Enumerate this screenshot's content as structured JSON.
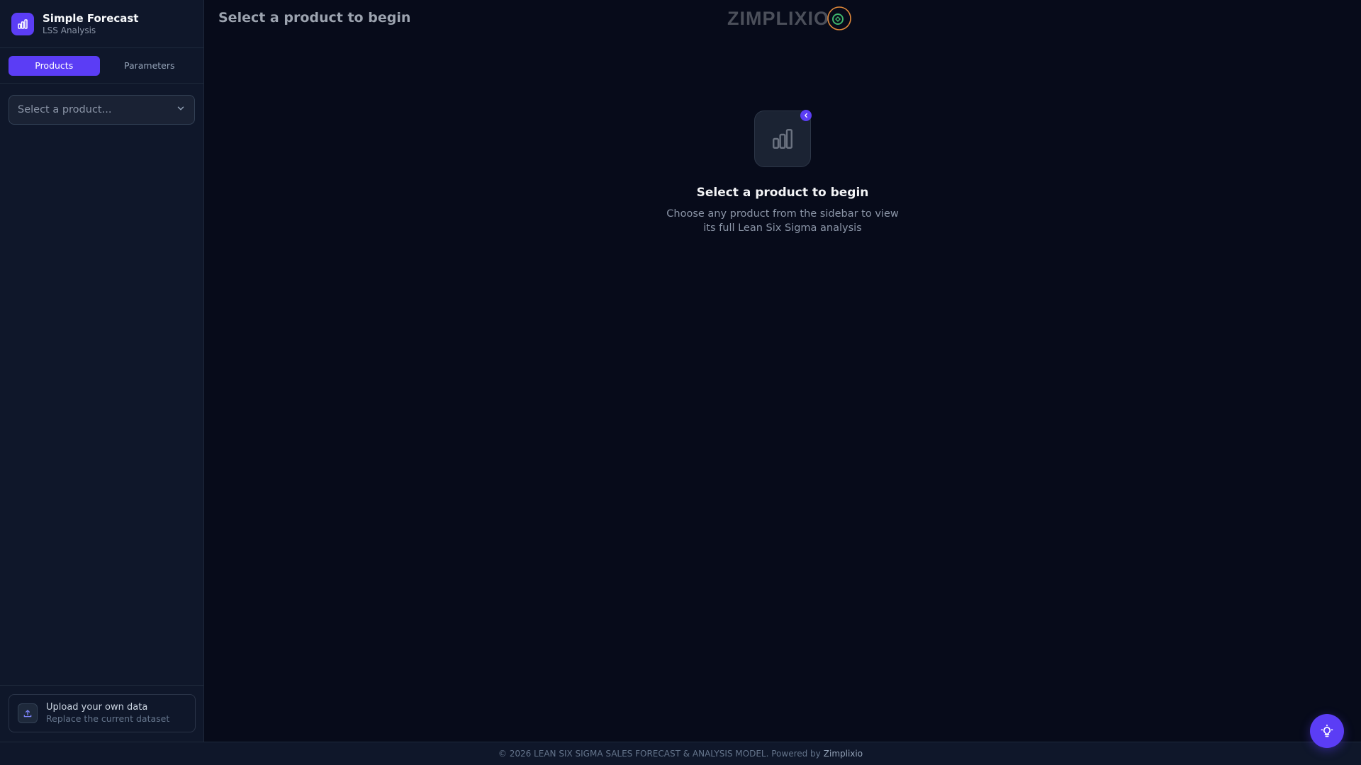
{
  "brand": {
    "title": "Simple Forecast",
    "subtitle": "LSS Analysis",
    "icon": "bar-chart-icon"
  },
  "tabs": [
    {
      "label": "Products",
      "active": true
    },
    {
      "label": "Parameters",
      "active": false
    }
  ],
  "product_select": {
    "placeholder": "Select a product..."
  },
  "upload": {
    "title": "Upload your own data",
    "subtitle": "Replace the current dataset",
    "icon": "upload-icon"
  },
  "header": {
    "title": "Select a product to begin",
    "logo_text": "ZIMPLIXIO"
  },
  "empty_state": {
    "title": "Select a product to begin",
    "description": "Choose any product from the sidebar to view its full Lean Six Sigma analysis",
    "icon": "bar-chart-icon"
  },
  "footer": {
    "text": "© 2026 LEAN SIX SIGMA SALES FORECAST & ANALYSIS MODEL. Powered by",
    "link": "Zimplixio"
  },
  "colors": {
    "accent": "#5b3df5",
    "background": "#070b1a",
    "sidebar": "#0f172a"
  }
}
